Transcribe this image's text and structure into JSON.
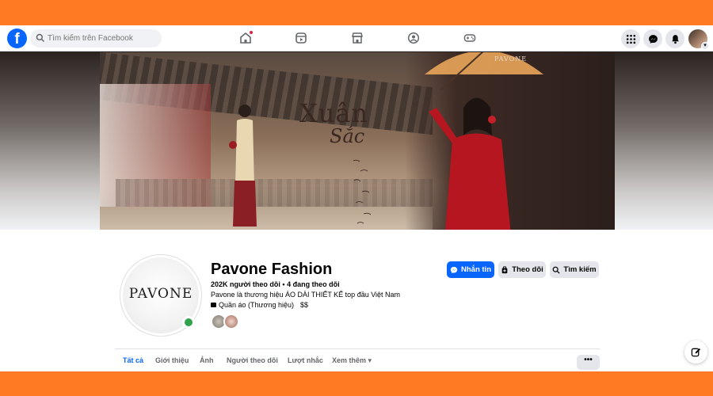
{
  "colors": {
    "frame_bg": "#ff7a22",
    "fb_blue": "#0866ff",
    "online_green": "#31a24c",
    "notification_red": "#e41e3f"
  },
  "topnav": {
    "logo": "f",
    "search_placeholder": "Tìm kiếm trên Facebook",
    "tabs": [
      {
        "icon": "home-icon",
        "active": false,
        "notification": true
      },
      {
        "icon": "video-icon",
        "active": false
      },
      {
        "icon": "marketplace-icon",
        "active": false
      },
      {
        "icon": "groups-icon",
        "active": false
      },
      {
        "icon": "gaming-icon",
        "active": false
      }
    ],
    "right_buttons": [
      "menu-grid-icon",
      "messenger-icon",
      "bell-icon",
      "account-avatar"
    ]
  },
  "cover": {
    "brand_mark": "PAVONE",
    "title_line1": "Xuân",
    "title_line2": "Sắc"
  },
  "profile": {
    "logo_text": "PAVONE",
    "name": "Pavone Fashion",
    "followers": "202K người theo dõi • 4 đang theo dõi",
    "bio": "Pavone là thương hiệu ÁO DÀI THIẾT KẾ top đầu Việt Nam",
    "category": "Quần áo (Thương hiệu)",
    "price": "$$"
  },
  "actions": {
    "message": "Nhắn tin",
    "follow": "Theo dõi",
    "search": "Tìm kiếm"
  },
  "tabs": [
    "Tất cả",
    "Giới thiệu",
    "Ảnh",
    "Người theo dõi",
    "Lượt nhắc",
    "Xem thêm ▾"
  ],
  "more_button": "•••"
}
